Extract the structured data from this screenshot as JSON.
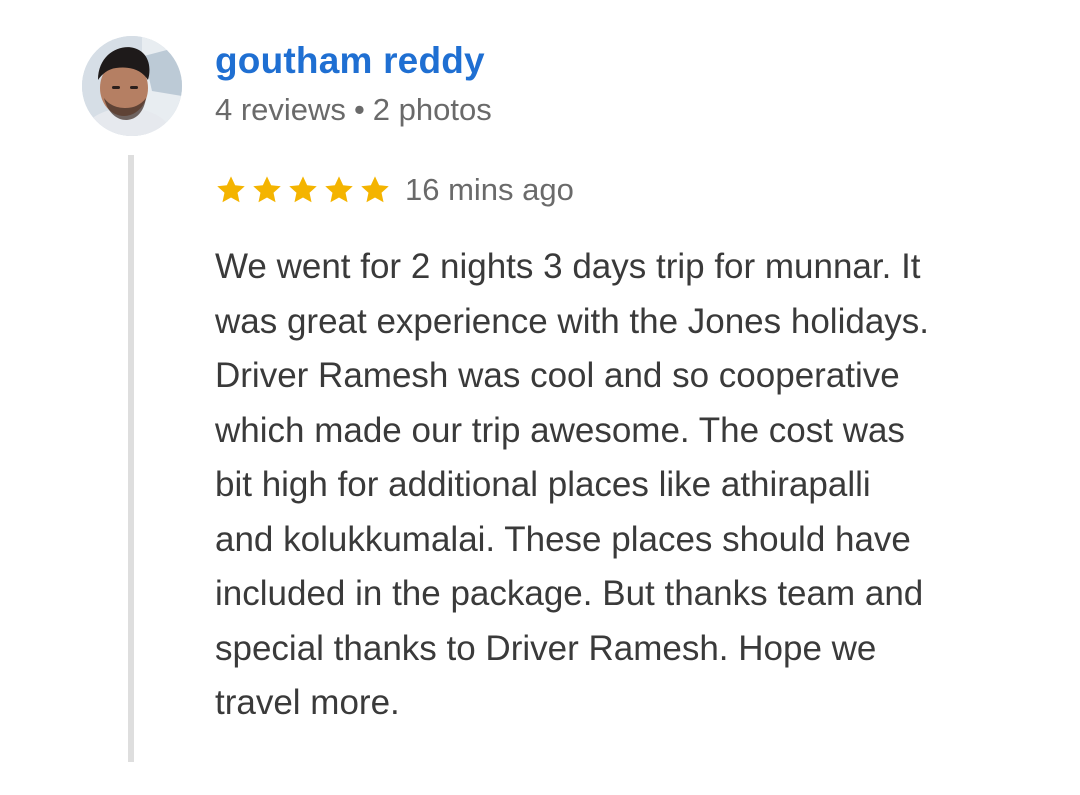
{
  "reviewer": {
    "name": "goutham reddy",
    "reviews": "4 reviews",
    "separator": "•",
    "photos": "2 photos"
  },
  "review": {
    "rating": 5,
    "rating_max": 5,
    "timestamp": "16 mins ago",
    "text_lines": [
      "We went for 2 nights 3 days trip for munnar. It",
      "was great experience with the Jones holidays.",
      "Driver Ramesh was cool and so cooperative",
      "which made our trip awesome. The cost was",
      "bit high for additional places like athirapalli",
      "and kolukkumalai. These places should have",
      "included in the package. But thanks team and",
      "special thanks to Driver Ramesh. Hope we",
      "travel more."
    ]
  },
  "colors": {
    "name": "#1f6fd2",
    "star": "#f4b400",
    "meta": "#6a6a6a",
    "body_text": "#3a3a3a",
    "rule": "#dedede"
  },
  "icons": {
    "avatar": "user-photo-avatar",
    "star": "star-icon"
  }
}
